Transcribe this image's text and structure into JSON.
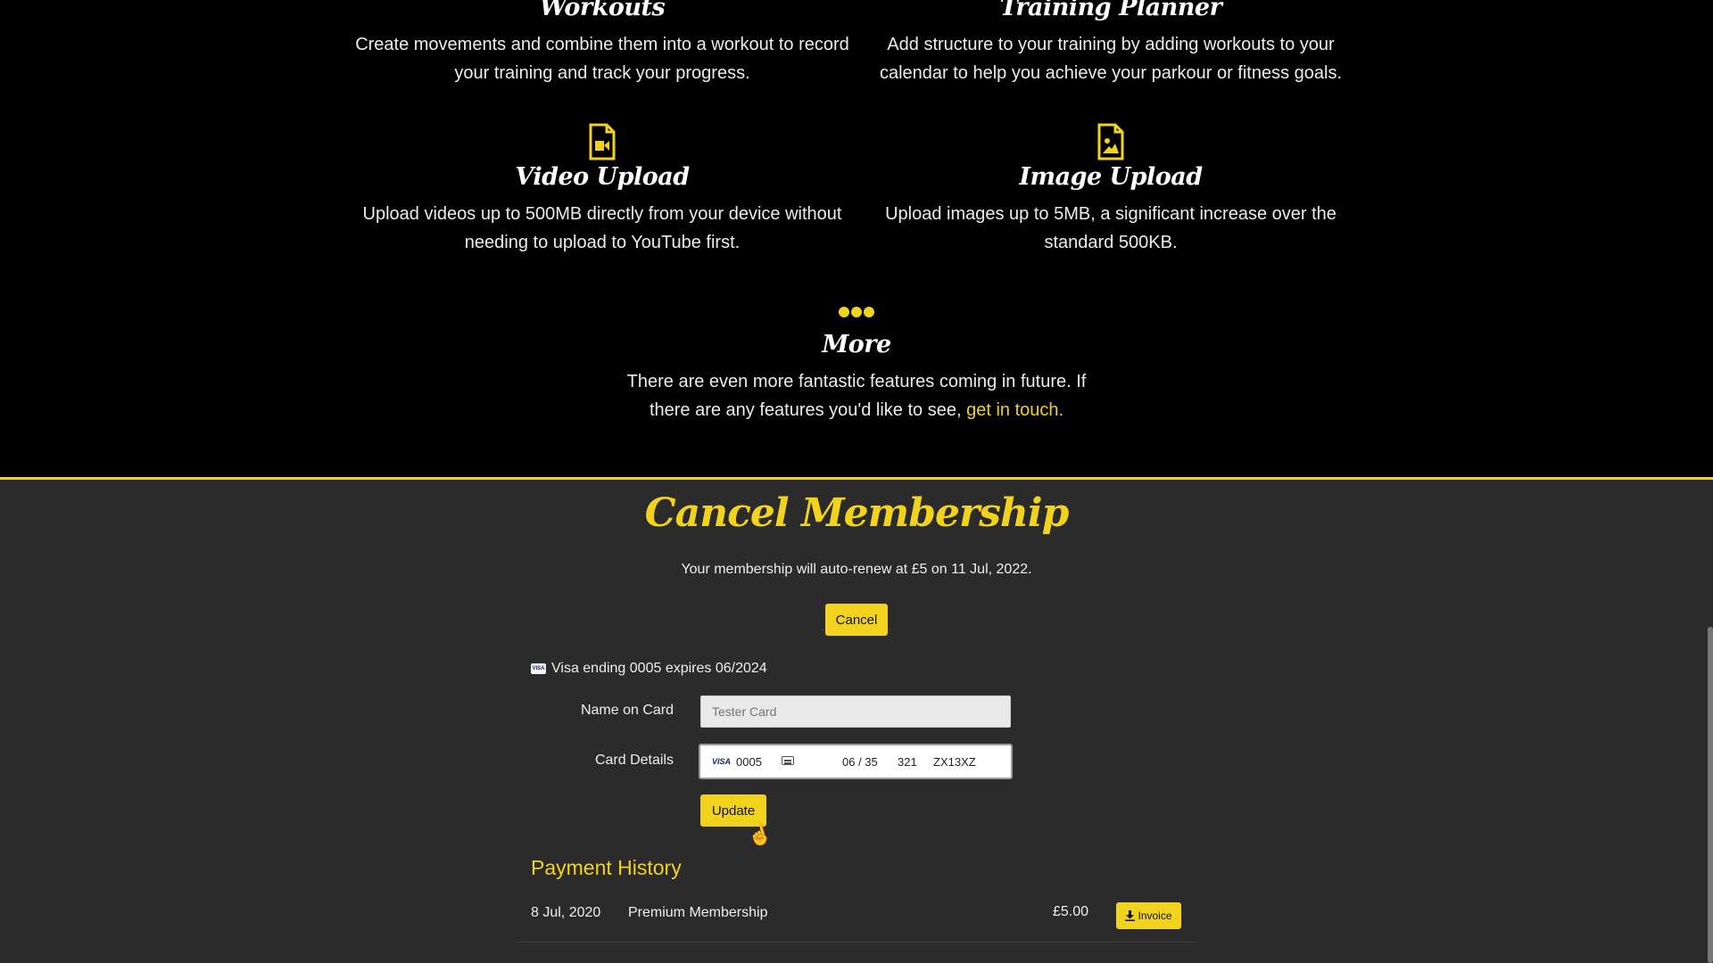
{
  "features": [
    {
      "title": "Workouts",
      "text": "Create movements and combine them into a workout to record your training and track your progress.",
      "icon": "none"
    },
    {
      "title": "Training Planner",
      "text": "Add structure to your training by adding workouts to your calendar to help you achieve your parkour or fitness goals.",
      "icon": "none"
    },
    {
      "title": "Video Upload",
      "text": "Upload videos up to 500MB directly from your device without needing to upload to YouTube first.",
      "icon": "file-video-icon"
    },
    {
      "title": "Image Upload",
      "text": "Upload images up to 5MB, a significant increase over the standard 500KB.",
      "icon": "file-image-icon"
    },
    {
      "title": "More",
      "text": "There are even more fantastic features coming in future. If there are any features you'd like to see,",
      "link": "get in touch.",
      "icon": "ellipsis-icon"
    }
  ],
  "membership": {
    "title": "Cancel Membership",
    "renew_text": "Your membership will auto-renew at £5 on 11 Jul, 2022.",
    "cancel_label": "Cancel",
    "card_summary": "Visa ending 0005 expires 06/2024",
    "card_brand_mini": "VISA",
    "name_label": "Name on Card",
    "name_value": "Tester Card",
    "card_label": "Card Details",
    "card": {
      "brand": "VISA",
      "last4": "0005",
      "expiry": "06 / 35",
      "cvc": "321",
      "postcode": "ZX13XZ"
    },
    "update_label": "Update"
  },
  "payment_history": {
    "title": "Payment History",
    "rows": [
      {
        "date": "8 Jul, 2020",
        "description": "Premium Membership",
        "amount": "£5.00",
        "invoice_label": "Invoice"
      }
    ]
  },
  "colors": {
    "accent": "#f1d21c",
    "panel": "#2b2b2b",
    "background": "#000000"
  }
}
